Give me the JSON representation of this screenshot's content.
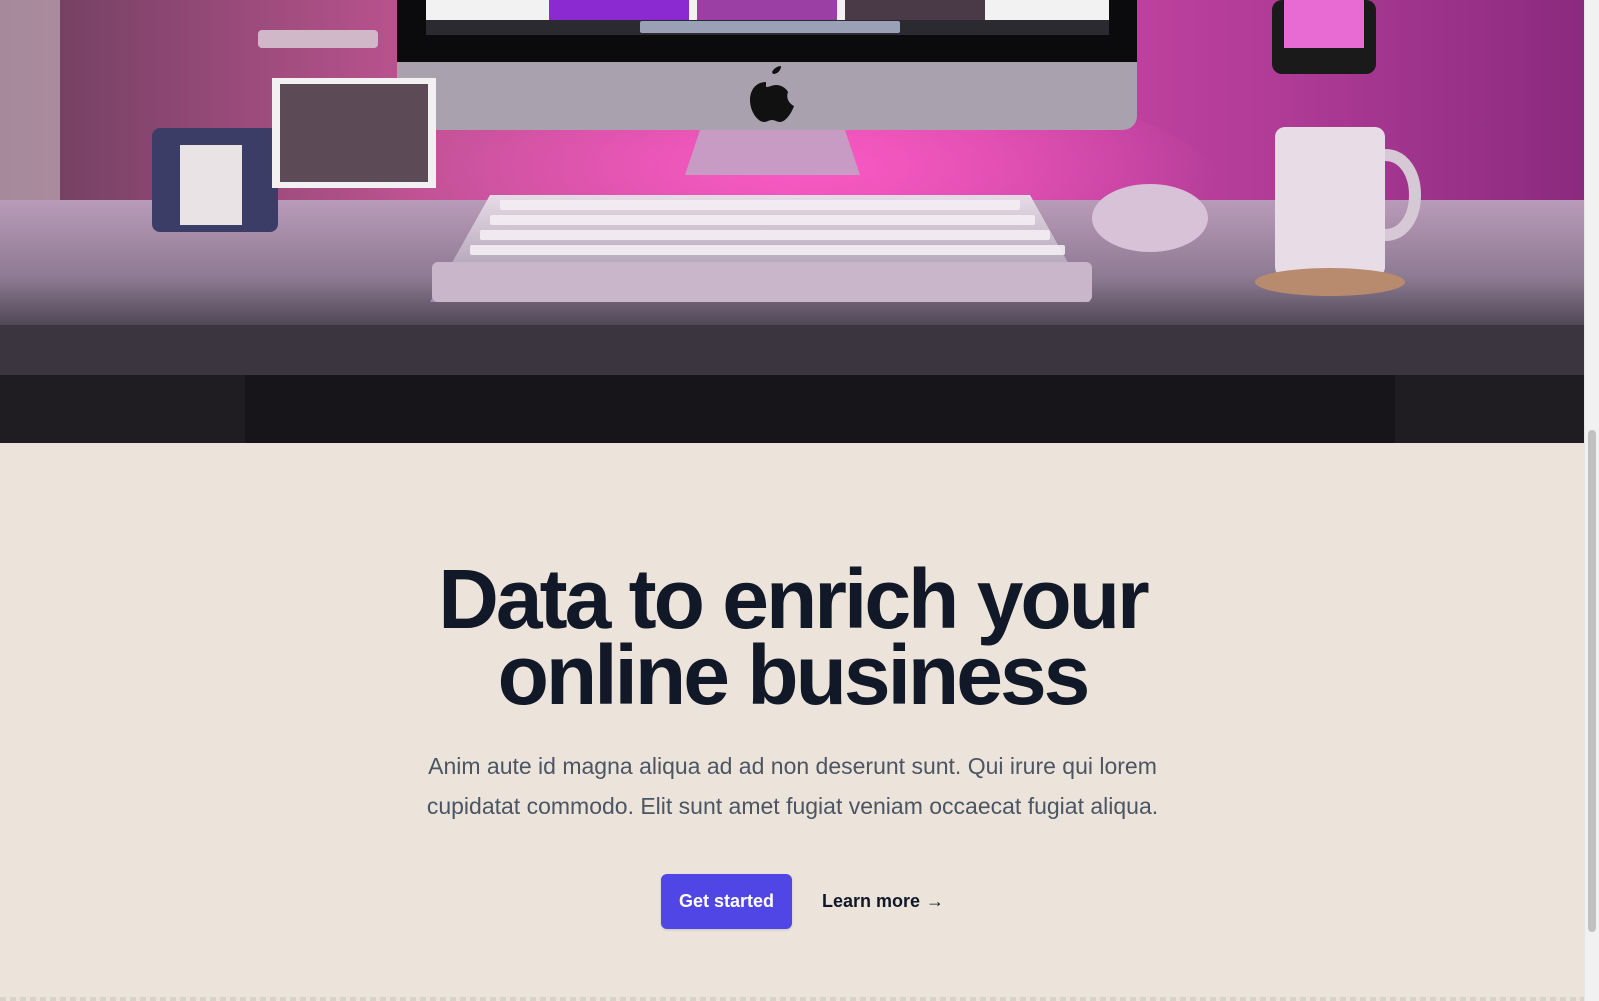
{
  "hero": {
    "image_alt": "Desk setup with iMac, mechanical keyboard, mouse and mug under pink lighting"
  },
  "headline": {
    "line1": "Data to enrich your",
    "line2": "online business"
  },
  "lead": {
    "line1": "Anim aute id magna aliqua ad ad non deserunt sunt. Qui irure qui lorem",
    "line2": "cupidatat commodo. Elit sunt amet fugiat veniam occaecat fugiat aliqua."
  },
  "actions": {
    "primary_label": "Get started",
    "secondary_label": "Learn more",
    "secondary_arrow": "→"
  },
  "colors": {
    "background": "#ece4da",
    "primary": "#4f46e5",
    "heading": "#111827",
    "body_text": "#4b5563"
  }
}
